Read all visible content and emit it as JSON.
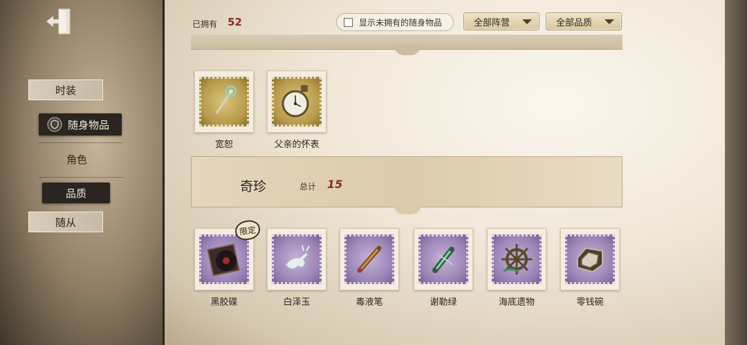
{
  "sidebar": {
    "exit_icon": "exit-door-icon",
    "items": [
      {
        "label": "时装",
        "style": "plain"
      },
      {
        "label": "随身物品",
        "style": "selected",
        "icon": "shield-emblem-icon"
      },
      {
        "label": "角色",
        "style": "text"
      },
      {
        "label": "品质",
        "style": "selected"
      },
      {
        "label": "随从",
        "style": "plain"
      }
    ]
  },
  "header": {
    "owned_label": "已拥有",
    "owned_count": "52",
    "show_unowned_label": "显示未拥有的随身物品",
    "camp_filter": "全部阵营",
    "quality_filter": "全部品质"
  },
  "top_items": [
    {
      "name": "宽恕",
      "icon": "staff-icon",
      "rarity": "gold"
    },
    {
      "name": "父亲的怀表",
      "icon": "pocket-watch-icon",
      "rarity": "gold"
    }
  ],
  "rarity_section": {
    "title": "奇珍",
    "total_label": "总计",
    "total": "15"
  },
  "items": [
    {
      "name": "黑胶碟",
      "icon": "vinyl-record-icon",
      "rarity": "purple",
      "badge": "限定"
    },
    {
      "name": "白泽玉",
      "icon": "jade-deer-icon",
      "rarity": "purple"
    },
    {
      "name": "毒液笔",
      "icon": "venom-pen-icon",
      "rarity": "purple"
    },
    {
      "name": "谢勒绿",
      "icon": "green-bottle-icon",
      "rarity": "purple"
    },
    {
      "name": "海底遗物",
      "icon": "ship-wheel-icon",
      "rarity": "purple"
    },
    {
      "name": "零钱碗",
      "icon": "coin-bowl-icon",
      "rarity": "purple"
    }
  ],
  "colors": {
    "accent_number": "#8a2a22",
    "selected_nav_bg": "#2a2521"
  }
}
